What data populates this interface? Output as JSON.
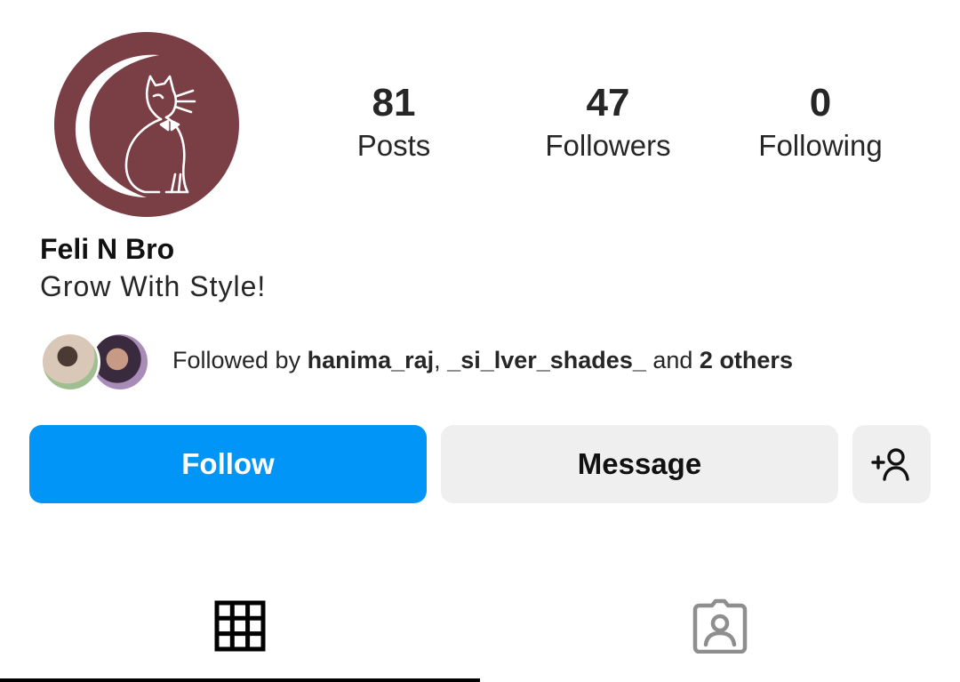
{
  "profile": {
    "name": "Feli N Bro",
    "bio": "Grow With Style!",
    "avatar_color": "#7a3e45"
  },
  "stats": [
    {
      "value": "81",
      "label": "Posts"
    },
    {
      "value": "47",
      "label": "Followers"
    },
    {
      "value": "0",
      "label": "Following"
    }
  ],
  "followed_by": {
    "prefix": "Followed by ",
    "user1": "hanima_raj",
    "sep": ", ",
    "user2": "_si_lver_shades_",
    "and": " and ",
    "others": "2 others"
  },
  "actions": {
    "follow_label": "Follow",
    "message_label": "Message",
    "add_icon": "add-person-icon",
    "follow_color": "#0095f6"
  },
  "tabs": [
    {
      "icon": "grid-icon",
      "active": true
    },
    {
      "icon": "tagged-icon",
      "active": false
    }
  ]
}
